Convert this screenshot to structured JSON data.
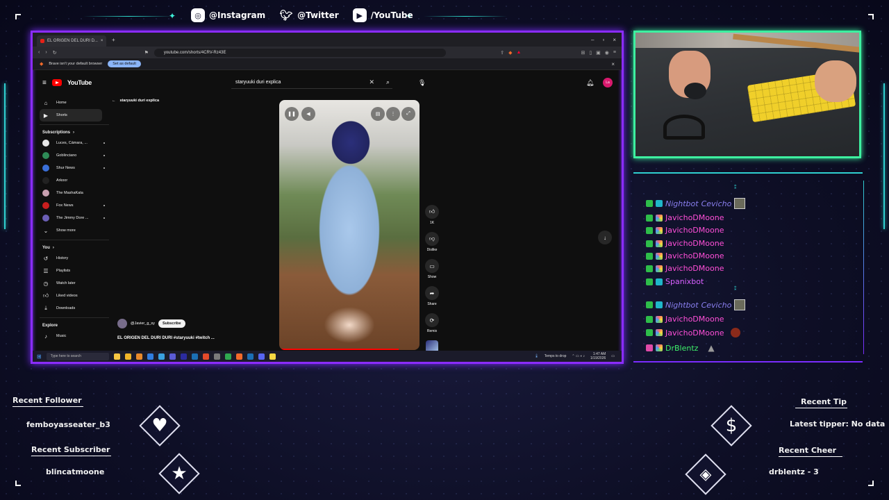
{
  "social": {
    "instagram": "@Instagram",
    "twitter": "@Twitter",
    "youtube": "/YouTube"
  },
  "browser": {
    "tab_title": "EL ORIGEN DEL DURI D...",
    "url": "youtube.com/shorts/4CRV-Rz43E",
    "infobar_text": "Brave isn't your default browser",
    "infobar_button": "Set as default"
  },
  "youtube": {
    "logo": "YouTube",
    "search_value": "staryuuki duri explica",
    "avatar_initials": "La",
    "back_title": "staryuuki duri explica",
    "sidebar": {
      "main": [
        {
          "label": "Home",
          "icon": "home-icon"
        },
        {
          "label": "Shorts",
          "icon": "shorts-icon"
        }
      ],
      "subscriptions_header": "Subscriptions",
      "subscriptions": [
        {
          "label": "Luces, Cámara, ...",
          "color": "#e6e6e6"
        },
        {
          "label": "GobIinciano",
          "color": "#2e8b57"
        },
        {
          "label": "Shur News",
          "color": "#3a6fd8"
        },
        {
          "label": "Arkoor",
          "color": "#222222"
        },
        {
          "label": "The MashaKata",
          "color": "#c8a0b0"
        },
        {
          "label": "Fox News",
          "color": "#c81e1e"
        },
        {
          "label": "The Jimmy Dore ...",
          "color": "#6b5fb5"
        }
      ],
      "show_more": "Show more",
      "you_header": "You",
      "you": [
        {
          "label": "History",
          "icon": "history-icon"
        },
        {
          "label": "Playlists",
          "icon": "playlists-icon"
        },
        {
          "label": "Watch later",
          "icon": "watch-later-icon"
        },
        {
          "label": "Liked videos",
          "icon": "liked-videos-icon"
        },
        {
          "label": "Downloads",
          "icon": "downloads-icon"
        }
      ],
      "explore_header": "Explore",
      "explore": [
        {
          "label": "Music",
          "icon": "music-icon"
        }
      ]
    },
    "actions": {
      "like_count": "1K",
      "dislike": "Dislike",
      "comments": "Show",
      "share": "Share",
      "remix": "Remix"
    },
    "channel_handle": "@Javier_g_sy",
    "subscribe": "Subscribe",
    "video_title": "EL ORIGEN DEL DURI DURI #staryuuki #twitch ..."
  },
  "taskbar": {
    "search_placeholder": "Type here to search",
    "weather": "Temps to drop",
    "time": "1:47 AM",
    "date": "1/19/2026"
  },
  "chat": [
    {
      "user": "Nightbot",
      "message": "Cevicho",
      "style": "nightbot"
    },
    {
      "user": "JavichoDMoone",
      "message": "",
      "style": "javicho"
    },
    {
      "user": "JavichoDMoone",
      "message": "",
      "style": "javicho"
    },
    {
      "user": "JavichoDMoone",
      "message": "",
      "style": "javicho"
    },
    {
      "user": "JavichoDMoone",
      "message": "",
      "style": "javicho"
    },
    {
      "user": "JavichoDMoone",
      "message": "",
      "style": "javicho"
    },
    {
      "user": "Spanixbot",
      "message": "",
      "style": "spanix"
    },
    {
      "user": "Nightbot",
      "message": "Cevicho",
      "style": "nightbot"
    },
    {
      "user": "JavichoDMoone",
      "message": "",
      "style": "javicho"
    },
    {
      "user": "JavichoDMoone",
      "message": "",
      "style": "javicho"
    },
    {
      "user": "DrBlentz",
      "message": "",
      "style": "drblentz"
    }
  ],
  "alerts": {
    "recent_follower_label": "Recent Follower",
    "recent_follower": "femboyasseater_b3",
    "recent_subscriber_label": "Recent Subscriber",
    "recent_subscriber": "blincatmoone",
    "recent_tip_label": "Recent Tip",
    "recent_tip": "Latest tipper: No data",
    "recent_cheer_label": "Recent Cheer",
    "recent_cheer": "drblentz - 3"
  },
  "colors": {
    "frame_border": "#8b2cff",
    "cam_border": "#3df0a0",
    "accent_cyan": "#2fe0d0"
  }
}
